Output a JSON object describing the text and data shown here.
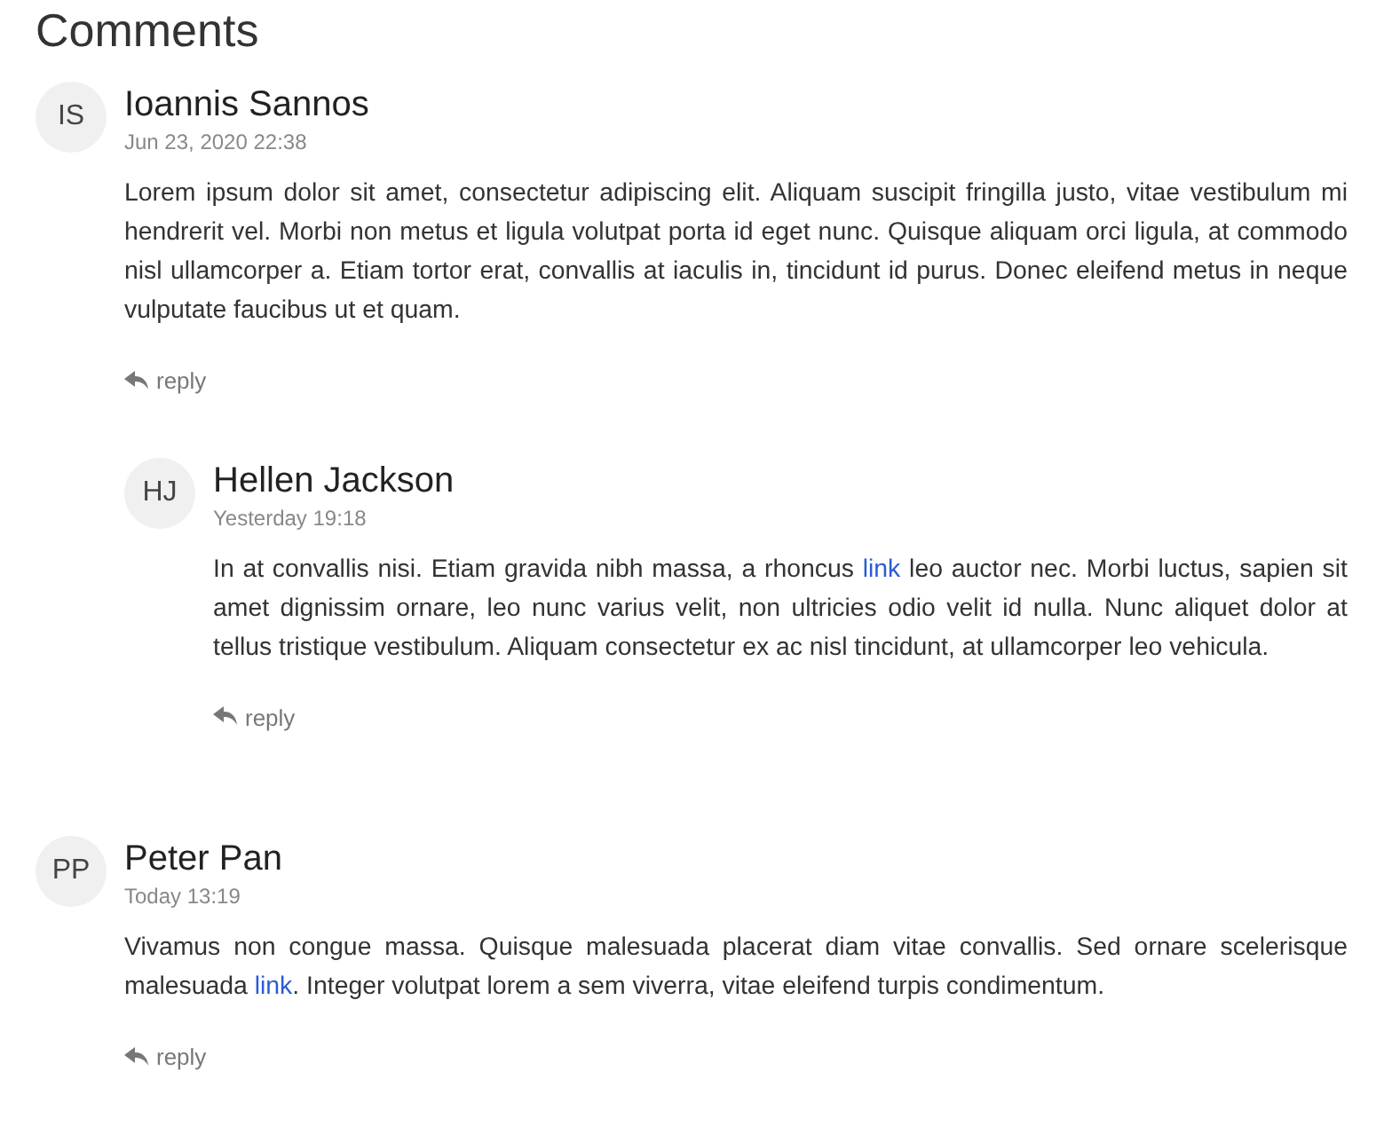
{
  "title": "Comments",
  "comments": [
    {
      "initials": "IS",
      "author": "Ioannis Sannos",
      "date": "Jun 23, 2020 22:38",
      "body": [
        {
          "kind": "text",
          "text": "Lorem ipsum dolor sit amet, consectetur adipiscing elit. Aliquam suscipit fringilla justo, vitae vestibulum mi hendrerit vel. Morbi non metus et ligula volutpat porta id eget nunc. Quisque aliquam orci ligula, at commodo nisl ullamcorper a. Etiam tortor erat, convallis at iaculis in, tincidunt id purus. Donec eleifend metus in neque vulputate faucibus ut et quam."
        }
      ],
      "reply": "reply",
      "children": [
        {
          "initials": "HJ",
          "author": "Hellen Jackson",
          "date": "Yesterday 19:18",
          "body": [
            {
              "kind": "text",
              "text": "In at convallis nisi. Etiam gravida nibh massa, a rhoncus "
            },
            {
              "kind": "link",
              "text": "link"
            },
            {
              "kind": "text",
              "text": " leo auctor nec. Morbi luctus, sapien sit amet dignissim ornare, leo nunc varius velit, non ultricies odio velit id nulla. Nunc aliquet dolor at tellus tristique vestibulum. Aliquam consectetur ex ac nisl tincidunt, at ullamcorper leo vehicula."
            }
          ],
          "reply": "reply"
        }
      ]
    },
    {
      "initials": "PP",
      "author": "Peter Pan",
      "date": "Today 13:19",
      "body": [
        {
          "kind": "text",
          "text": "Vivamus non congue massa. Quisque malesuada placerat diam vitae convallis. Sed ornare scelerisque malesuada "
        },
        {
          "kind": "link",
          "text": "link"
        },
        {
          "kind": "text",
          "text": ". Integer volutpat lorem a sem viverra, vitae eleifend turpis condimentum."
        }
      ],
      "reply": "reply"
    }
  ]
}
